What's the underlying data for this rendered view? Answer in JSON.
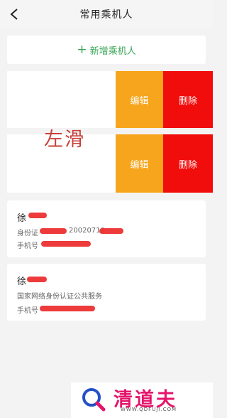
{
  "header": {
    "title": "常用乘机人"
  },
  "add_passenger": {
    "label": "新增乘机人",
    "icon": "plus-icon"
  },
  "swiped_cards": [
    {
      "edit_label": "编辑",
      "delete_label": "删除"
    },
    {
      "edit_label": "编辑",
      "delete_label": "删除"
    }
  ],
  "annotation": {
    "text": "左滑"
  },
  "passengers": [
    {
      "name": "徐",
      "id_line": "身份证",
      "id_visible": "20020710",
      "phone_line": "手机号"
    },
    {
      "name": "徐",
      "id_line": "国家网络身份认证公共服务",
      "phone_line": "手机号"
    }
  ],
  "watermark": {
    "brand": "清道夫",
    "url": "WWW.QDFUJI.COM"
  },
  "colors": {
    "accent_green": "#3aa657",
    "edit_orange": "#f7a51c",
    "delete_red": "#f20d0d",
    "annotation_red": "#c8403a",
    "watermark_pink": "#e5156b"
  }
}
